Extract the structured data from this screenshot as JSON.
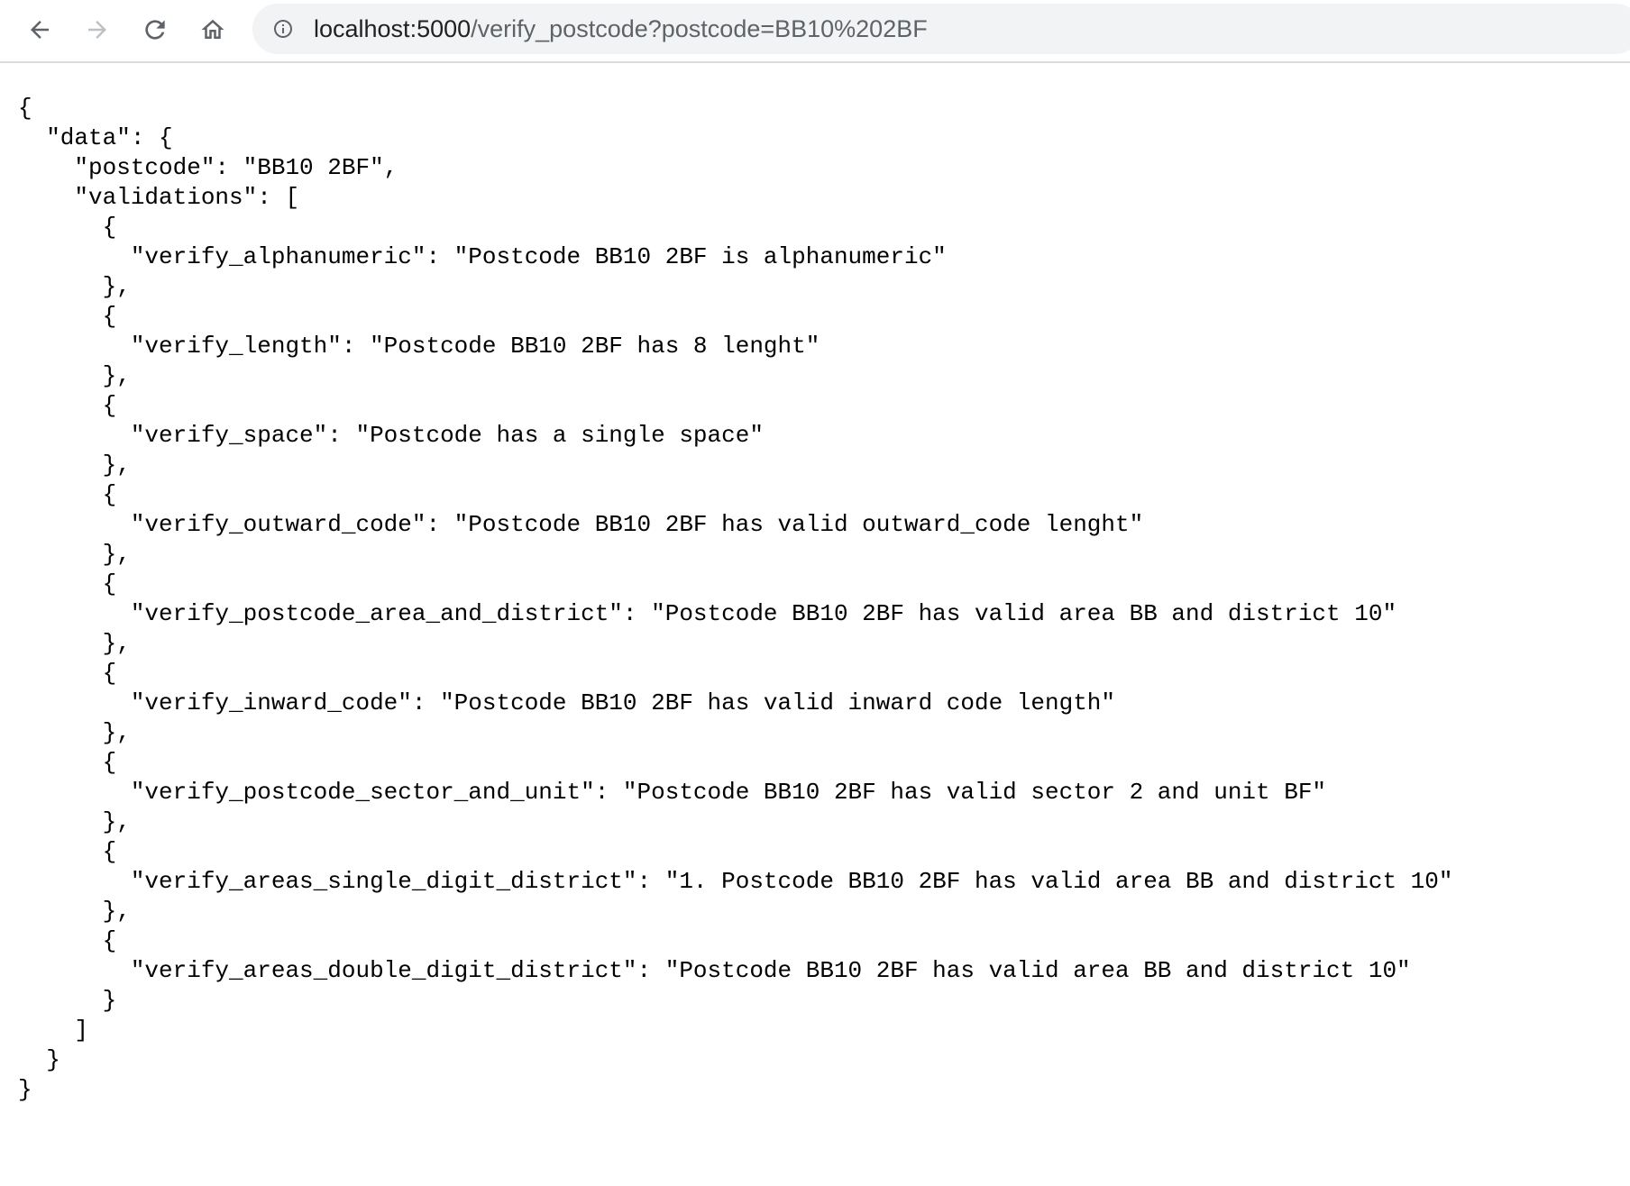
{
  "browser": {
    "url_host": "localhost:5000",
    "url_path": "/verify_postcode?postcode=BB10%202BF",
    "back_icon": "arrow-left",
    "forward_icon": "arrow-right",
    "reload_icon": "reload",
    "home_icon": "home",
    "info_icon": "info-circle"
  },
  "json": {
    "line_01": "{",
    "line_02": "  \"data\": {",
    "line_03": "    \"postcode\": \"BB10 2BF\",",
    "line_04": "    \"validations\": [",
    "line_05": "      {",
    "line_06": "        \"verify_alphanumeric\": \"Postcode BB10 2BF is alphanumeric\"",
    "line_07": "      },",
    "line_08": "      {",
    "line_09": "        \"verify_length\": \"Postcode BB10 2BF has 8 lenght\"",
    "line_10": "      },",
    "line_11": "      {",
    "line_12": "        \"verify_space\": \"Postcode has a single space\"",
    "line_13": "      },",
    "line_14": "      {",
    "line_15": "        \"verify_outward_code\": \"Postcode BB10 2BF has valid outward_code lenght\"",
    "line_16": "      },",
    "line_17": "      {",
    "line_18": "        \"verify_postcode_area_and_district\": \"Postcode BB10 2BF has valid area BB and district 10\"",
    "line_19": "      },",
    "line_20": "      {",
    "line_21": "        \"verify_inward_code\": \"Postcode BB10 2BF has valid inward code length\"",
    "line_22": "      },",
    "line_23": "      {",
    "line_24": "        \"verify_postcode_sector_and_unit\": \"Postcode BB10 2BF has valid sector 2 and unit BF\"",
    "line_25": "      },",
    "line_26": "      {",
    "line_27": "        \"verify_areas_single_digit_district\": \"1. Postcode BB10 2BF has valid area BB and district 10\"",
    "line_28": "      },",
    "line_29": "      {",
    "line_30": "        \"verify_areas_double_digit_district\": \"Postcode BB10 2BF has valid area BB and district 10\"",
    "line_31": "      }",
    "line_32": "    ]",
    "line_33": "  }",
    "line_34": "}"
  }
}
